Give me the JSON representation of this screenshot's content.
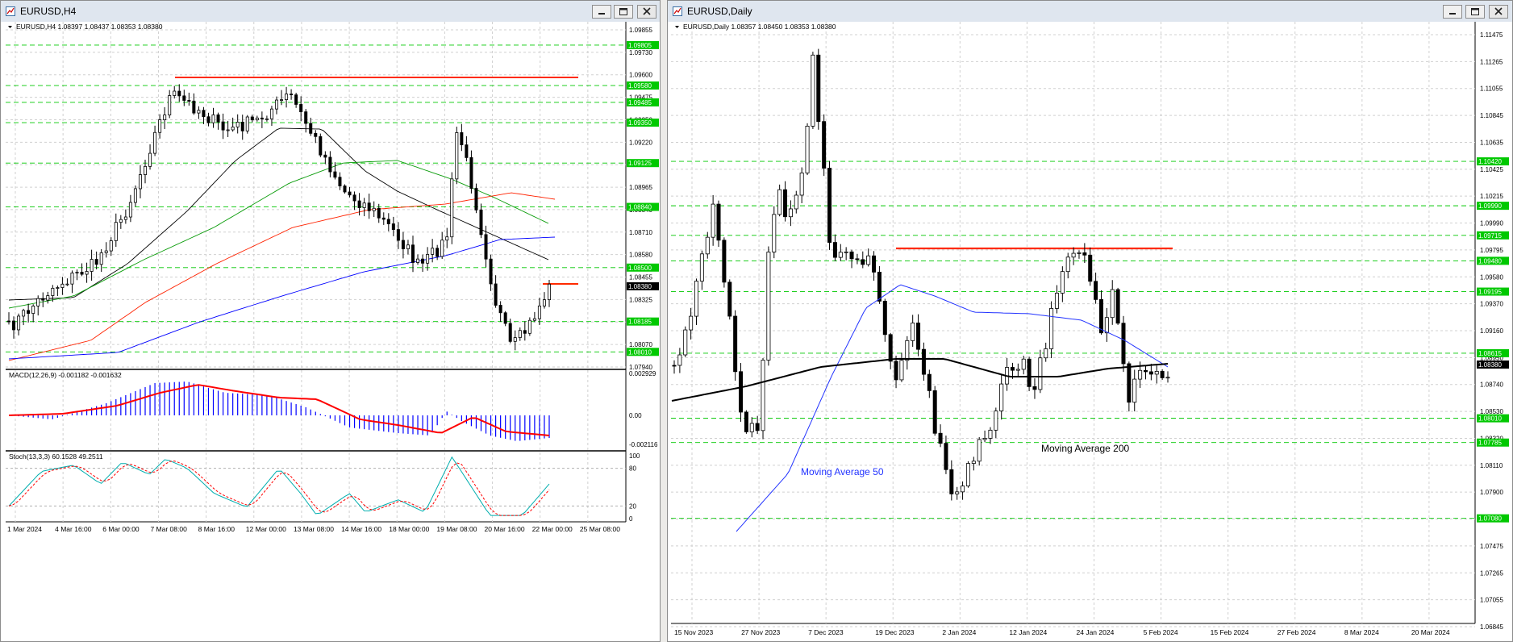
{
  "h4": {
    "window_title": "EURUSD,H4",
    "info": "EURUSD,H4  1.08397 1.08437 1.08353 1.08380",
    "macd_label": "MACD(12,26,9) -0.001182 -0.001632",
    "stoch_label": "Stoch(13,3,3) 60.1528 49.2511",
    "price_ticks": [
      "1.09855",
      "1.09730",
      "1.09600",
      "1.09475",
      "1.09350",
      "1.09220",
      "1.09090",
      "1.08965",
      "1.08840",
      "1.08710",
      "1.08580",
      "1.08455",
      "1.08325",
      "1.08200",
      "1.08070",
      "1.07940"
    ],
    "green_levels": [
      "1.09805",
      "1.09580",
      "1.09485",
      "1.09350",
      "1.09125",
      "1.08840",
      "1.08500",
      "1.08185",
      "1.08010"
    ],
    "current_price": "1.08380",
    "macd_ticks": [
      "0.002929",
      "0.00",
      "-0.002116"
    ],
    "stoch_ticks": [
      "100",
      "80",
      "20",
      "0"
    ],
    "time_labels": [
      "1 Mar 2024",
      "4 Mar 16:00",
      "6 Mar 00:00",
      "7 Mar 08:00",
      "8 Mar 16:00",
      "12 Mar 00:00",
      "13 Mar 08:00",
      "14 Mar 16:00",
      "18 Mar 00:00",
      "19 Mar 08:00",
      "20 Mar 16:00",
      "22 Mar 00:00",
      "25 Mar 08:00"
    ],
    "colors": {
      "resistance": "#ff2a00",
      "ma_black": "#000000",
      "ma_green": "#0a9c0a",
      "ma_red": "#ff2200",
      "ma_blue": "#0000ff",
      "macd_hist": "#0000ff",
      "macd_signal": "#ff0000",
      "stoch_main": "#00aeae",
      "stoch_signal": "#ff0000",
      "level_green": "#00c800"
    }
  },
  "daily": {
    "window_title": "EURUSD,Daily",
    "info": "EURUSD,Daily  1.08357 1.08450 1.08353 1.08380",
    "price_ticks": [
      "1.11475",
      "1.11265",
      "1.11055",
      "1.10845",
      "1.10635",
      "1.10425",
      "1.10215",
      "1.09990",
      "1.09795",
      "1.09580",
      "1.09370",
      "1.09160",
      "1.08950",
      "1.08740",
      "1.08530",
      "1.08320",
      "1.08110",
      "1.07900",
      "1.07685",
      "1.07475",
      "1.07265",
      "1.07055",
      "1.06845"
    ],
    "green_levels": [
      "1.10420",
      "1.09990",
      "1.09715",
      "1.09480",
      "1.09195",
      "1.08615",
      "1.08010",
      "1.07785",
      "1.07080"
    ],
    "current_price": "1.08380",
    "time_labels": [
      "15 Nov 2023",
      "27 Nov 2023",
      "7 Dec 2023",
      "19 Dec 2023",
      "2 Jan 2024",
      "12 Jan 2024",
      "24 Jan 2024",
      "5 Feb 2024",
      "15 Feb 2024",
      "27 Feb 2024",
      "8 Mar 2024",
      "20 Mar 2024"
    ],
    "label_ma50": "Moving Average 50",
    "label_ma200": "Moving Average 200",
    "colors": {
      "resistance": "#ff2a00",
      "ma50": "#2233ff",
      "ma200": "#000000",
      "level_green": "#00c800"
    }
  }
}
